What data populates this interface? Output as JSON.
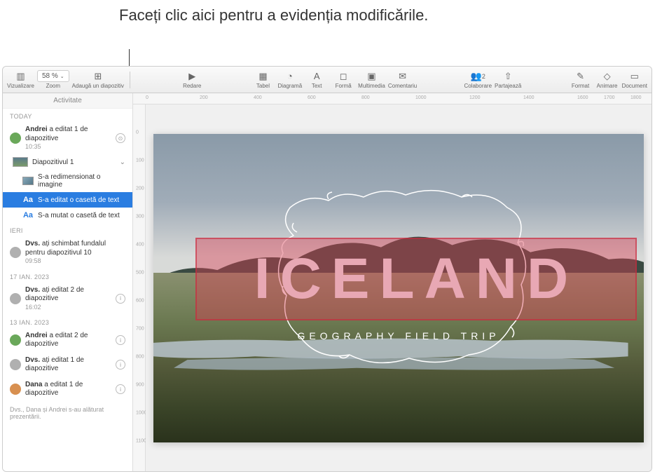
{
  "callout": "Faceți clic aici pentru a evidenția modificările.",
  "toolbar": {
    "view": "Vizualizare",
    "zoom": "Zoom",
    "zoom_value": "58 %",
    "add_slide": "Adaugă un diapozitiv",
    "play": "Redare",
    "table": "Tabel",
    "chart": "Diagramă",
    "text": "Text",
    "shape": "Formă",
    "media": "Multimedia",
    "comment": "Comentariu",
    "collab": "Colaborare",
    "collab_count": "2",
    "share": "Partajează",
    "format": "Format",
    "animate": "Animare",
    "document": "Document"
  },
  "sidebar": {
    "header": "Activitate",
    "today": "TODAY",
    "yesterday": "IERI",
    "date1": "17 IAN. 2023",
    "date2": "13 IAN. 2023",
    "e1_text": "Andrei a editat 1 de diapozitive",
    "e1_time": "10:35",
    "slide1": "Diapozitivul 1",
    "c1": "S-a redimensionat o imagine",
    "c2": "S-a editat o casetă de text",
    "c3": "S-a mutat o casetă de text",
    "e2_text": "Dvs. ați schimbat fundalul pentru diapozitivul 10",
    "e2_time": "09:58",
    "e3_text": "Dvs. ați editat 2 de diapozitive",
    "e3_time": "16:02",
    "e4_text": "Andrei a editat 2 de diapozitive",
    "e5_text": "Dvs. ați editat 1 de diapozitive",
    "e6_text": "Dana a editat 1 de diapozitive",
    "joined": "Dvs., Dana și Andrei s-au alăturat prezentării."
  },
  "slide": {
    "title": "ICELAND",
    "subtitle": "GEOGRAPHY FIELD TRIP"
  },
  "ruler_h": [
    "0",
    "200",
    "400",
    "600",
    "800",
    "1000",
    "1200",
    "1400",
    "1600",
    "1700",
    "1800"
  ],
  "ruler_v": [
    "0",
    "100",
    "200",
    "300",
    "400",
    "500",
    "600",
    "700",
    "800",
    "900",
    "1000",
    "1100"
  ]
}
